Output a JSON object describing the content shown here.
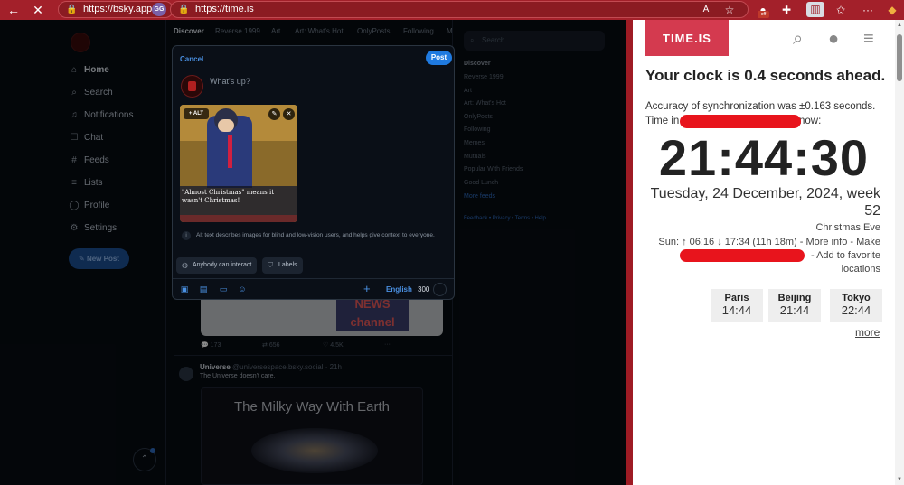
{
  "browser": {
    "tab1_url": "https://bsky.app",
    "tab1_badge": "GG",
    "tab2_url": "https://time.is",
    "ext_badge": "off",
    "reader_label": "A"
  },
  "bsky": {
    "nav": [
      {
        "label": "Home",
        "icon": "home-icon"
      },
      {
        "label": "Search",
        "icon": "search-icon"
      },
      {
        "label": "Notifications",
        "icon": "bell-icon"
      },
      {
        "label": "Chat",
        "icon": "chat-icon"
      },
      {
        "label": "Feeds",
        "icon": "hash-icon"
      },
      {
        "label": "Lists",
        "icon": "list-icon"
      },
      {
        "label": "Profile",
        "icon": "profile-icon"
      },
      {
        "label": "Settings",
        "icon": "gear-icon"
      }
    ],
    "new_post": "New Post",
    "feed_tabs": [
      "Discover",
      "Reverse 1999",
      "Art",
      "Art: What's Hot",
      "OnlyPosts",
      "Following",
      "M"
    ],
    "search_placeholder": "Search",
    "right_list": [
      "Discover",
      "Reverse 1999",
      "Art",
      "Art: What's Hot",
      "OnlyPosts",
      "Following",
      "Memes",
      "Mutuals",
      "Popular With Friends",
      "Good Lunch",
      "More feeds"
    ],
    "footer_links": "Feedback • Privacy • Terms • Help",
    "post_counts": {
      "replies": "173",
      "reposts": "656",
      "likes": "4.5K"
    },
    "post_author": "Universe",
    "post_handle": "@universespace.bsky.social · 21h",
    "post_body": "The Universe doesn't care.",
    "galaxy_title": "The Milky Way With Earth",
    "news_text": "NEWS channel"
  },
  "composer": {
    "cancel": "Cancel",
    "post": "Post",
    "placeholder": "What's up?",
    "alt_button": "+ ALT",
    "image_caption": "\"Almost Christmas\" means it wasn't Christmas!",
    "alt_info": "Alt text describes images for blind and low-vision users, and helps give context to everyone.",
    "chip_interact": "Anybody can interact",
    "chip_labels": "Labels",
    "language": "English",
    "char_count": "300"
  },
  "timeis": {
    "logo": "TIME.IS",
    "headline": "Your clock is 0.4 seconds ahead.",
    "accuracy": "Accuracy of synchronization was ±0.163 seconds.",
    "time_in_prefix": "Time in",
    "time_in_suffix": "now:",
    "clock": "21:44:30",
    "date": "Tuesday, 24 December, 2024, week 52",
    "holiday": "Christmas Eve",
    "sun": "Sun: ↑ 06:16 ↓ 17:34 (11h 18m) - More info - Make",
    "favorites": "- Add to favorite locations",
    "cities": [
      {
        "name": "Paris",
        "time": "14:44"
      },
      {
        "name": "Beijing",
        "time": "21:44"
      },
      {
        "name": "Tokyo",
        "time": "22:44"
      }
    ],
    "more": "more"
  }
}
